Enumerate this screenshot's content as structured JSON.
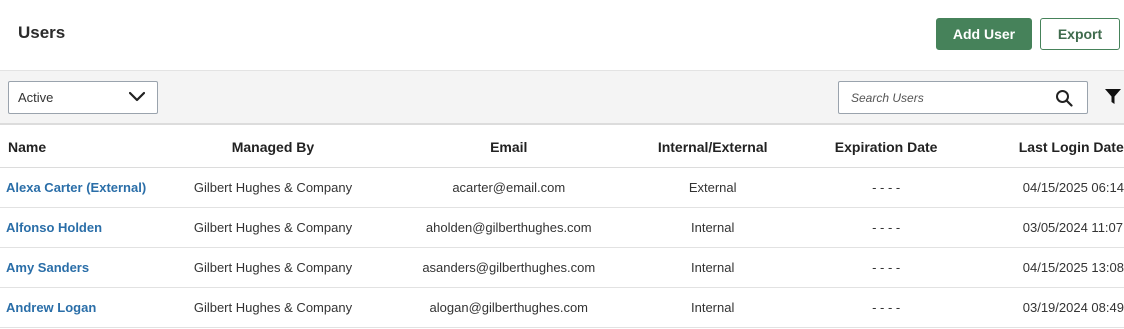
{
  "header": {
    "title": "Users",
    "add_user_label": "Add User",
    "export_label": "Export"
  },
  "toolbar": {
    "status_select": {
      "selected": "Active"
    },
    "search": {
      "placeholder": "Search Users",
      "value": ""
    }
  },
  "table": {
    "columns": [
      "Name",
      "Managed By",
      "Email",
      "Internal/External",
      "Expiration Date",
      "Last Login Date"
    ],
    "rows": [
      {
        "name": "Alexa Carter (External)",
        "managed_by": "Gilbert Hughes & Company",
        "email": "acarter@email.com",
        "type": "External",
        "expiration": "- - - -",
        "last_login": "04/15/2025 06:14"
      },
      {
        "name": "Alfonso Holden",
        "managed_by": "Gilbert Hughes & Company",
        "email": "aholden@gilberthughes.com",
        "type": "Internal",
        "expiration": "- - - -",
        "last_login": "03/05/2024 11:07"
      },
      {
        "name": "Amy Sanders",
        "managed_by": "Gilbert Hughes & Company",
        "email": "asanders@gilberthughes.com",
        "type": "Internal",
        "expiration": "- - - -",
        "last_login": "04/15/2025 13:08"
      },
      {
        "name": "Andrew Logan",
        "managed_by": "Gilbert Hughes & Company",
        "email": "alogan@gilberthughes.com",
        "type": "Internal",
        "expiration": "- - - -",
        "last_login": "03/19/2024 08:49"
      }
    ]
  },
  "colors": {
    "primary": "#46825a",
    "link": "#2a6ea8",
    "toolbar_bg": "#f4f4f4"
  },
  "icons": [
    "chevron-down-icon",
    "search-icon",
    "filter-icon"
  ]
}
